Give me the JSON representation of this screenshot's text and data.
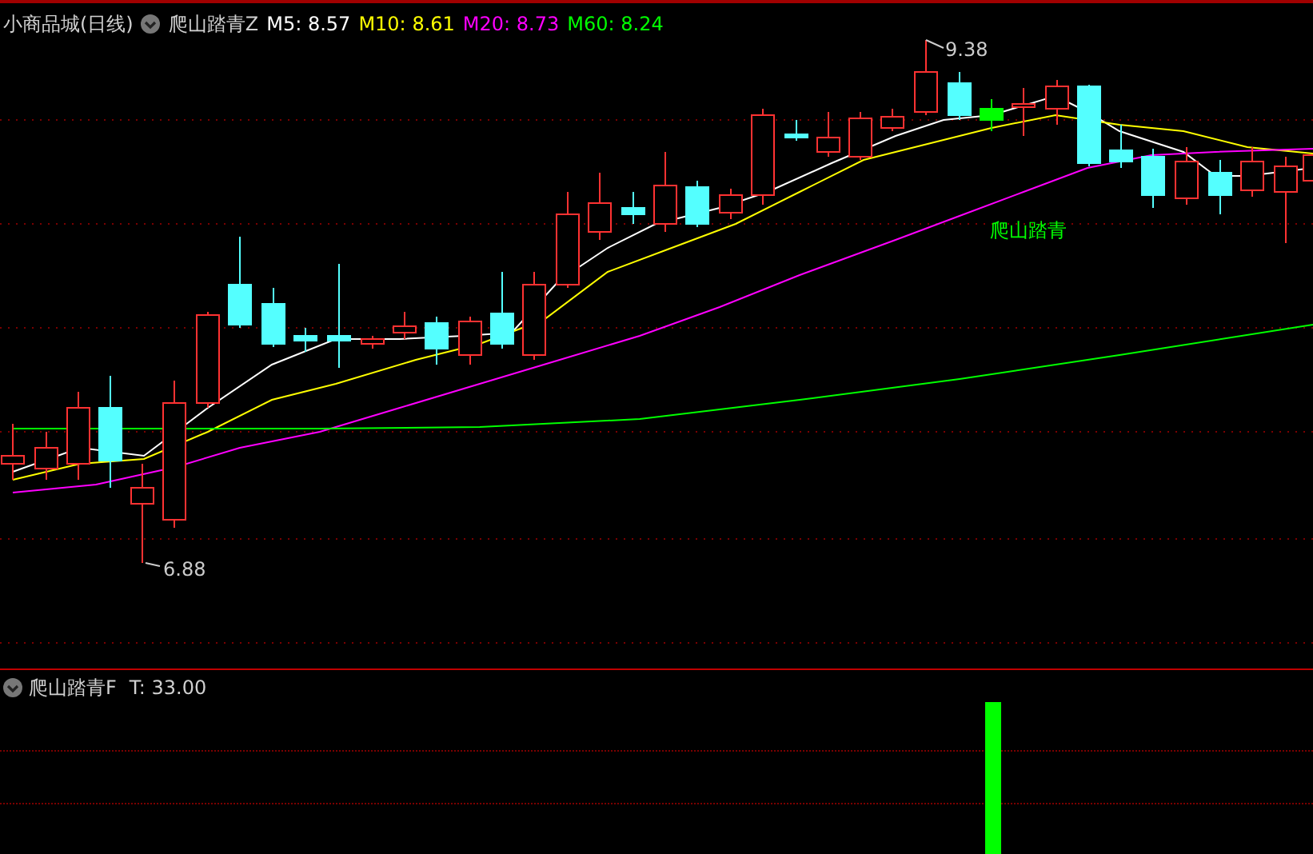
{
  "main_panel": {
    "title": "小商品城(日线)",
    "indicator": "爬山踏青Z",
    "moving_averages": [
      {
        "label": "M5:",
        "value": "8.57",
        "color": "#ffffff"
      },
      {
        "label": "M10:",
        "value": "8.61",
        "color": "#ffff00"
      },
      {
        "label": "M20:",
        "value": "8.73",
        "color": "#ff00ff"
      },
      {
        "label": "M60:",
        "value": "8.24",
        "color": "#00ff00"
      }
    ],
    "high_label": "9.38",
    "low_label": "6.88",
    "signal_label": "爬山踏青"
  },
  "sub_panel": {
    "indicator": "爬山踏青F",
    "reading": "T: 33.00"
  }
}
